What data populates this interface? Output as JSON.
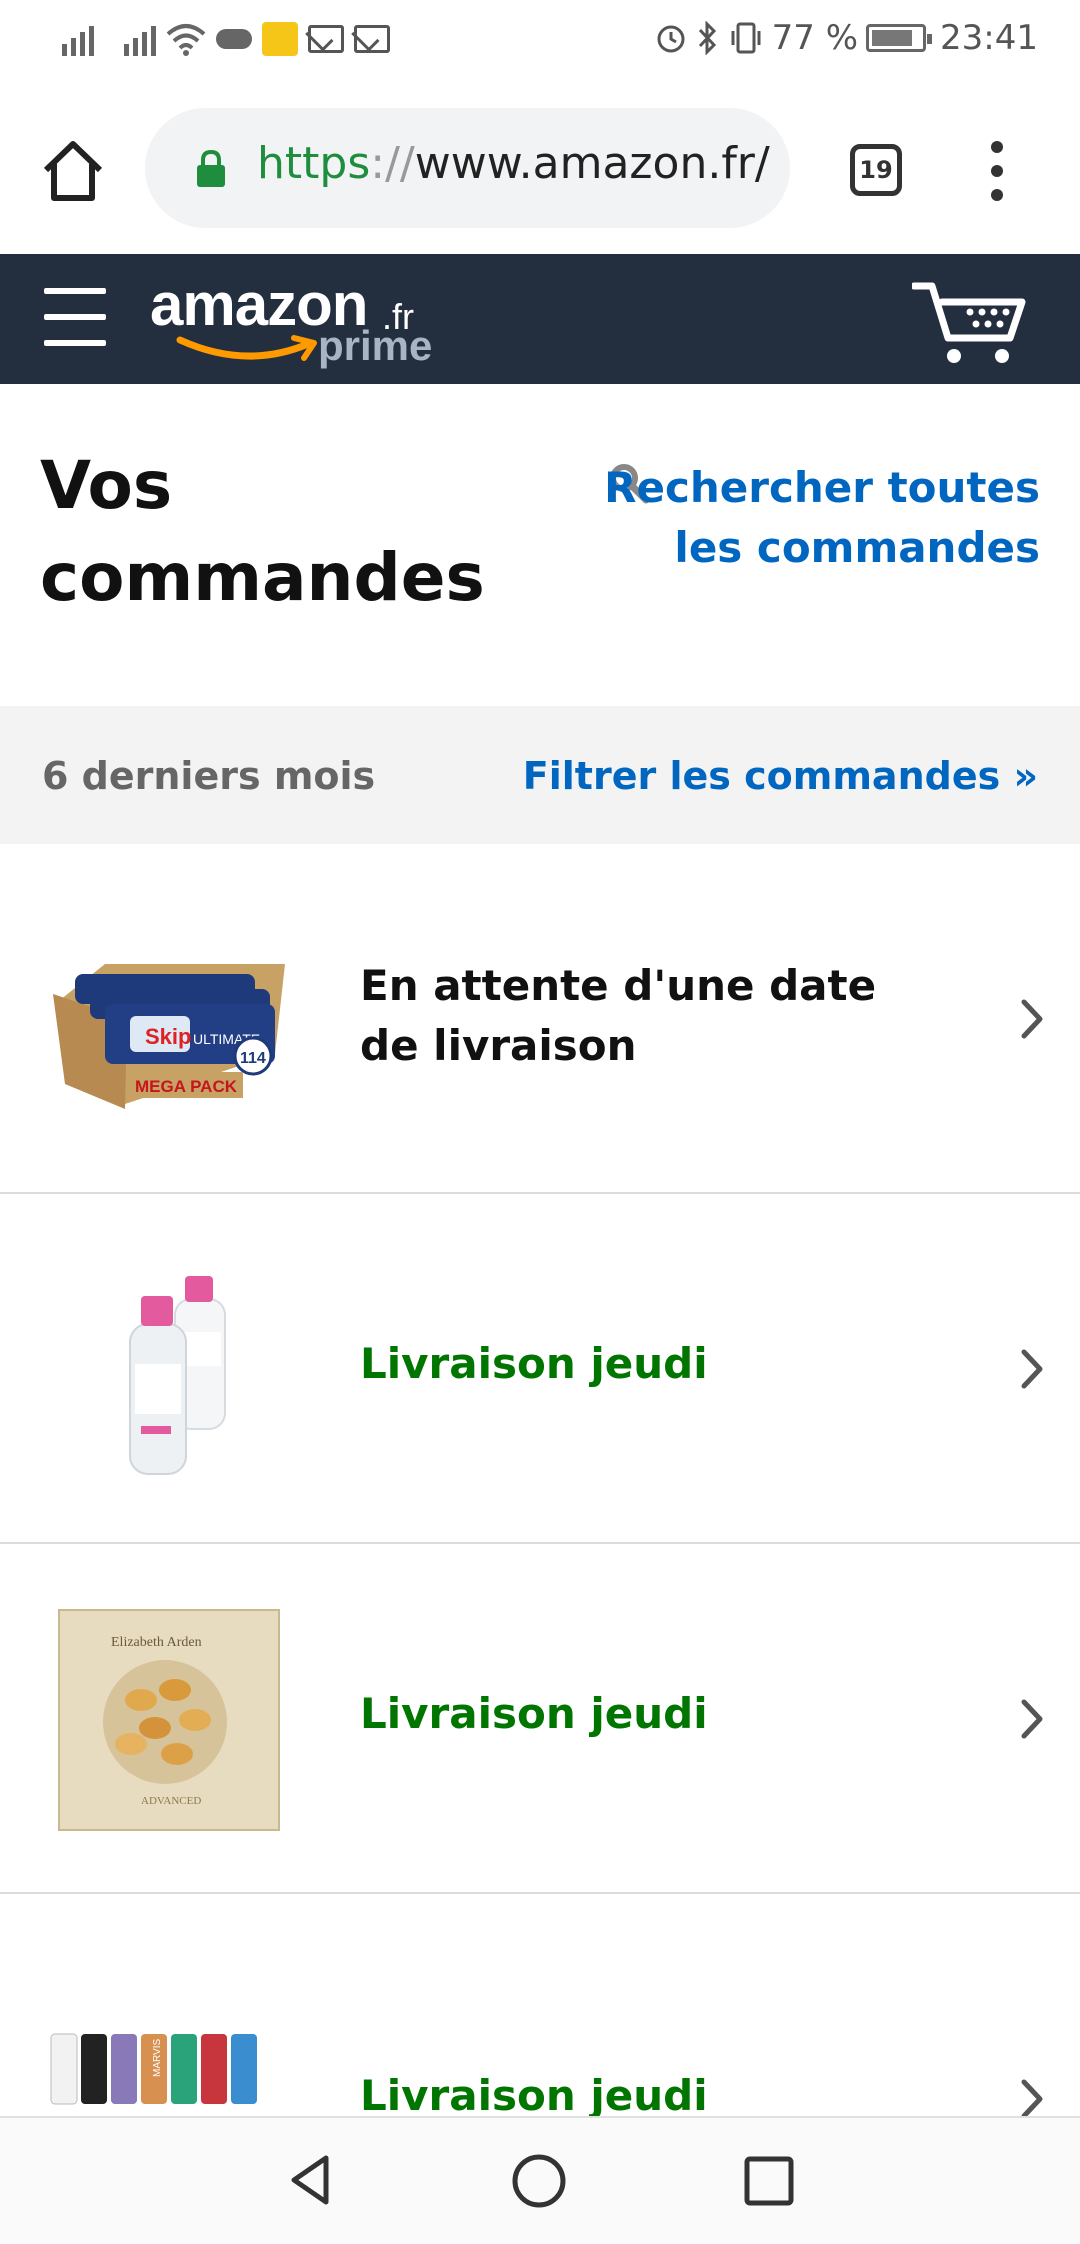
{
  "status_bar": {
    "battery": "77 %",
    "time": "23:41"
  },
  "browser": {
    "url_scheme": "https",
    "url_sep": "://",
    "url_host": "www.amazon.fr/",
    "tab_count": "19"
  },
  "amazon_header": {
    "logo_word": "amazon",
    "logo_tld": ".fr",
    "logo_prime": "prime"
  },
  "page": {
    "title": "Vos commandes",
    "search_link": "Rechercher toutes les commandes"
  },
  "filter": {
    "period": "6 derniers mois",
    "filter_link": "Filtrer les commandes »"
  },
  "orders": [
    {
      "status": "En attente d'une date de livraison",
      "status_color": "#111111",
      "product_icon": "skip-detergent-mega-pack"
    },
    {
      "status": "Livraison jeudi",
      "status_color": "#007600",
      "product_icon": "micellar-water-bottles"
    },
    {
      "status": "Livraison jeudi",
      "status_color": "#007600",
      "product_icon": "elizabeth-arden-capsules-box"
    },
    {
      "status": "Livraison jeudi",
      "status_color": "#007600",
      "product_icon": "marvis-toothpaste-set"
    }
  ],
  "colors": {
    "header_bg": "#232f3e",
    "link_blue": "#0066c0",
    "delivery_green": "#007600"
  },
  "product_texts": {
    "skip_brand": "Skip",
    "skip_sub": "ULTIMATE",
    "skip_badge": "MEGA PACK",
    "skip_count": "114",
    "ea_brand": "Elizabeth Arden",
    "ea_sub": "ADVANCED",
    "marvis": "MARVIS"
  }
}
